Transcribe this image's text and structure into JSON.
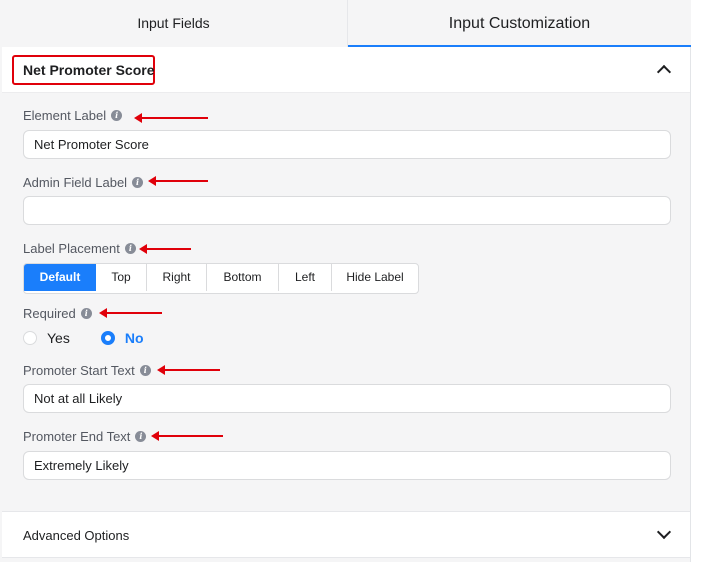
{
  "tabs": [
    {
      "label": "Input Fields",
      "active": false
    },
    {
      "label": "Input Customization",
      "active": true
    }
  ],
  "section": {
    "title": "Net Promoter Score",
    "collapse_icon": "chevron-up-icon"
  },
  "fields": {
    "element_label": {
      "label": "Element Label",
      "value": "Net Promoter Score"
    },
    "admin_field_label": {
      "label": "Admin Field Label",
      "value": ""
    },
    "label_placement": {
      "label": "Label Placement",
      "options": [
        "Default",
        "Top",
        "Right",
        "Bottom",
        "Left",
        "Hide Label"
      ],
      "selected": "Default"
    },
    "required": {
      "label": "Required",
      "options": [
        "Yes",
        "No"
      ],
      "selected": "No"
    },
    "promoter_start_text": {
      "label": "Promoter Start Text",
      "value": "Not at all Likely"
    },
    "promoter_end_text": {
      "label": "Promoter End Text",
      "value": "Extremely Likely"
    }
  },
  "advanced": {
    "title": "Advanced Options",
    "expand_icon": "chevron-down-icon"
  },
  "colors": {
    "accent": "#1a7efb",
    "annotation": "#e0000a"
  }
}
